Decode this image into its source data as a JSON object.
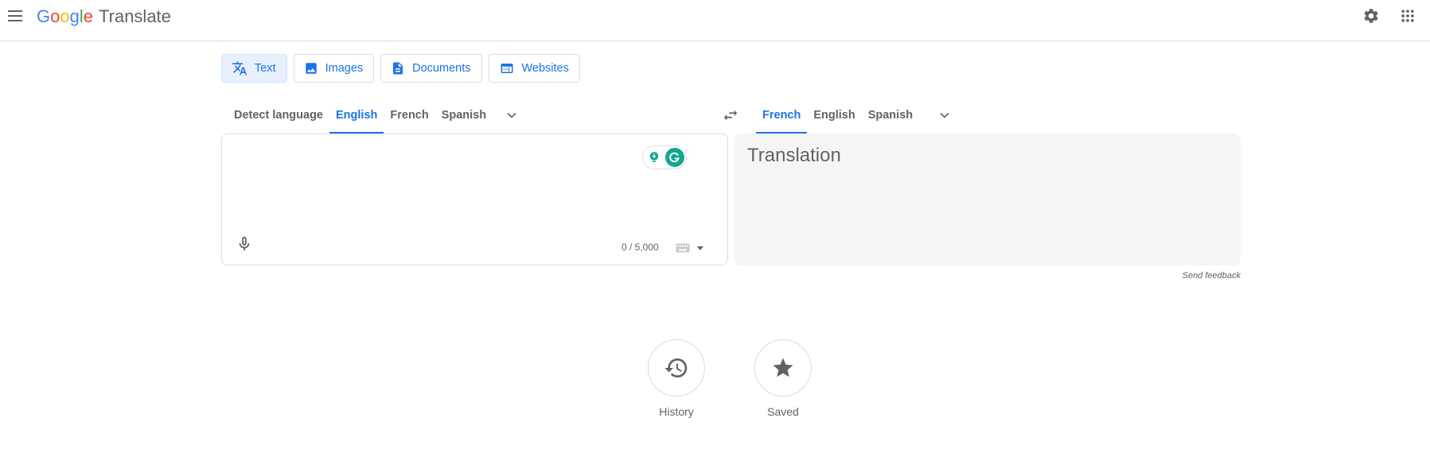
{
  "header": {
    "brand_letters": [
      {
        "ch": "G",
        "color": "#4285f4"
      },
      {
        "ch": "o",
        "color": "#ea4335"
      },
      {
        "ch": "o",
        "color": "#fbbc05"
      },
      {
        "ch": "g",
        "color": "#4285f4"
      },
      {
        "ch": "l",
        "color": "#34a853"
      },
      {
        "ch": "e",
        "color": "#ea4335"
      }
    ],
    "product": "Translate",
    "icons": [
      "menu-icon",
      "settings-gear-icon",
      "apps-grid-icon"
    ]
  },
  "mode_tabs": [
    {
      "label": "Text",
      "icon": "translate-icon",
      "active": true
    },
    {
      "label": "Images",
      "icon": "image-icon",
      "active": false
    },
    {
      "label": "Documents",
      "icon": "document-icon",
      "active": false
    },
    {
      "label": "Websites",
      "icon": "website-icon",
      "active": false
    }
  ],
  "source_langs": [
    "Detect language",
    "English",
    "French",
    "Spanish"
  ],
  "source_active": "English",
  "target_langs": [
    "French",
    "English",
    "Spanish"
  ],
  "target_active": "French",
  "source": {
    "char_count": "0 / 5,000"
  },
  "target": {
    "placeholder": "Translation"
  },
  "feedback": "Send feedback",
  "actions": {
    "history": "History",
    "saved": "Saved"
  },
  "colors": {
    "accent": "#1a73e8",
    "grammarly": "#15a68f"
  }
}
